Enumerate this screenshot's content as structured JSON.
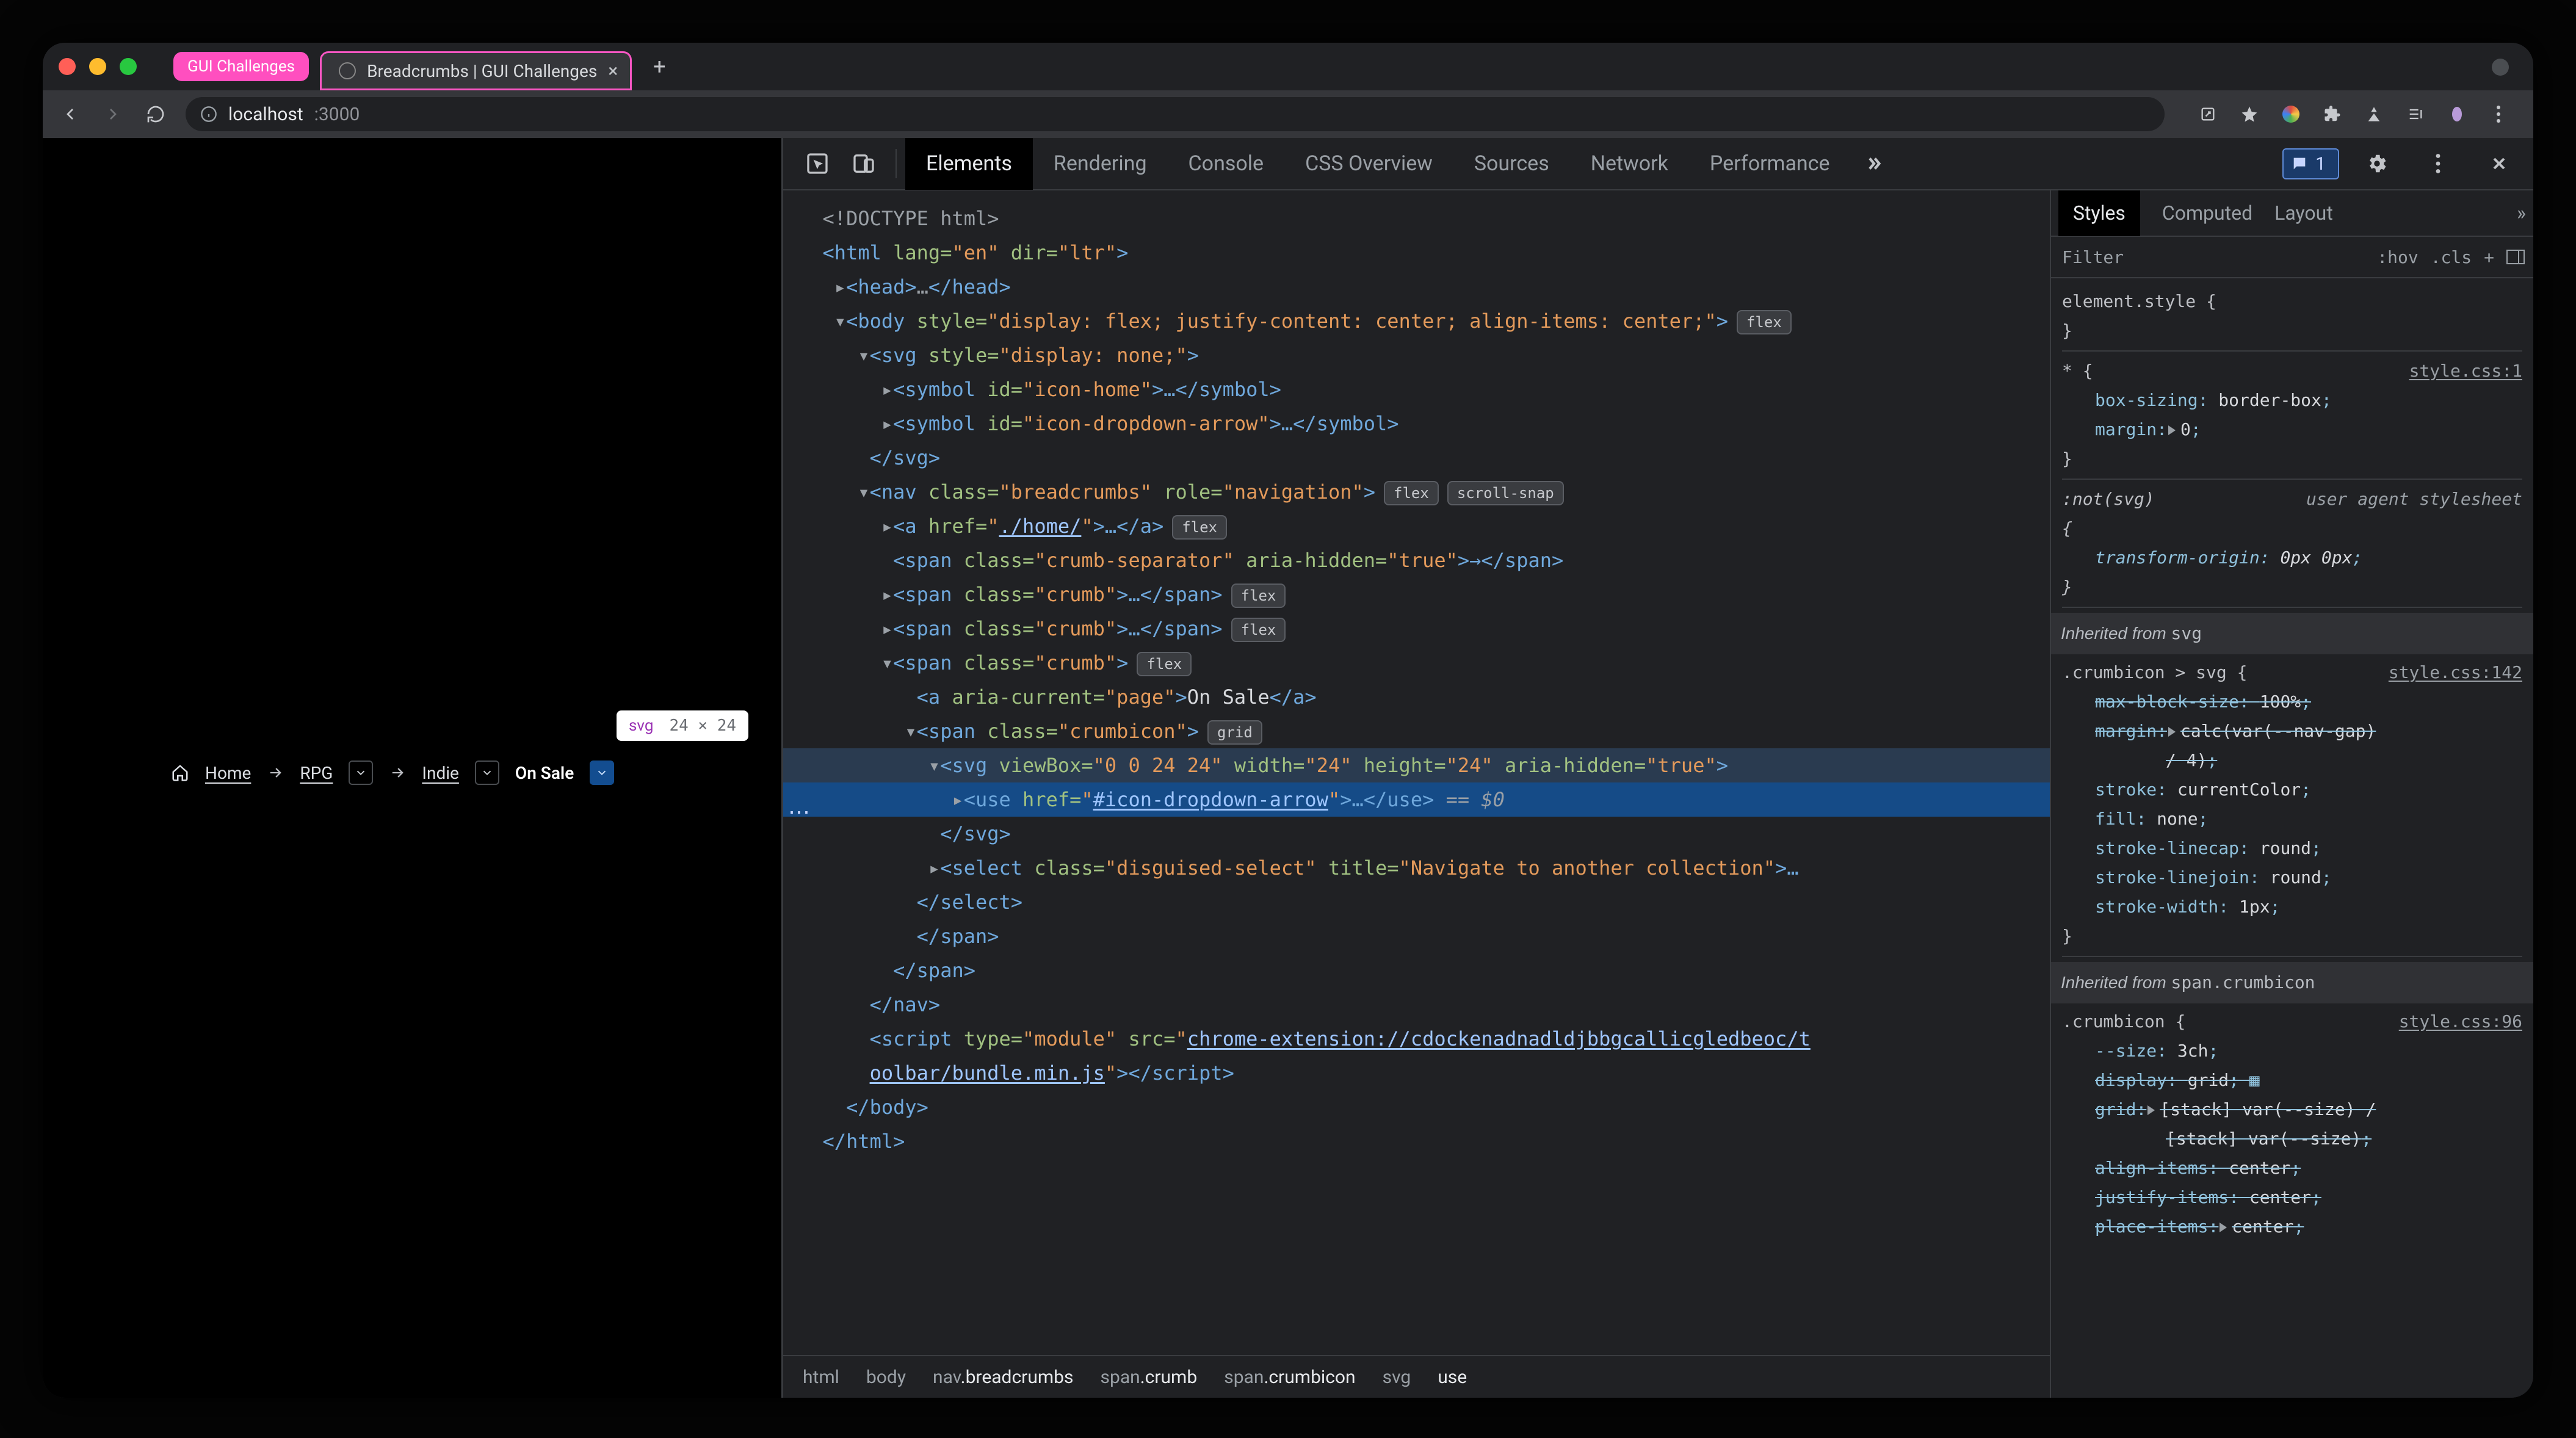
{
  "traffic": {
    "close": "#ff5f57",
    "min": "#febc2e",
    "max": "#28c840"
  },
  "tabs": {
    "pill": "GUI Challenges",
    "active": "Breadcrumbs | GUI Challenges"
  },
  "addr": {
    "host": "localhost",
    "port": ":3000"
  },
  "page": {
    "breadcrumbs": {
      "home": "Home",
      "rpg": "RPG",
      "indie": "Indie",
      "sale": "On Sale"
    },
    "tooltip": {
      "tag": "svg",
      "dim": "24 × 24"
    }
  },
  "devtools": {
    "tabs": [
      "Elements",
      "Rendering",
      "Console",
      "CSS Overview",
      "Sources",
      "Network",
      "Performance"
    ],
    "issues": "1",
    "dom": {
      "l1": "<!DOCTYPE html>",
      "l2": {
        "open": "<html ",
        "a1": "lang=",
        "v1": "\"en\"",
        "a2": " dir=",
        "v2": "\"ltr\"",
        "close": ">"
      },
      "l3": "<head>…</head>",
      "l4": {
        "open": "<body ",
        "a1": "style=",
        "v1": "\"display: flex; justify-content: center; align-items: center;\"",
        "close": ">",
        "badge": "flex"
      },
      "l5": {
        "open": "<svg ",
        "a1": "style=",
        "v1": "\"display: none;\"",
        "close": ">"
      },
      "l6": {
        "sym1": "<symbol ",
        "a1": "id=",
        "v1": "\"icon-home\"",
        "mid": ">…</symbol>"
      },
      "l7": {
        "sym1": "<symbol ",
        "a1": "id=",
        "v1": "\"icon-dropdown-arrow\"",
        "mid": ">…</symbol>"
      },
      "l8": "</svg>",
      "l9": {
        "open": "<nav ",
        "a1": "class=",
        "v1": "\"breadcrumbs\"",
        "a2": " role=",
        "v2": "\"navigation\"",
        "close": ">",
        "b1": "flex",
        "b2": "scroll-snap"
      },
      "l10": {
        "open": "<a ",
        "a1": "href=",
        "v1": "\"./home/\"",
        "mid": ">…</a>",
        "badge": "flex"
      },
      "l11": {
        "open": "<span ",
        "a1": "class=",
        "v1": "\"crumb-separator\"",
        "a2": " aria-hidden=",
        "v2": "\"true\"",
        "mid": ">→</span>"
      },
      "l12": {
        "open": "<span ",
        "a1": "class=",
        "v1": "\"crumb\"",
        "mid": ">…</span>",
        "badge": "flex"
      },
      "l13": {
        "open": "<span ",
        "a1": "class=",
        "v1": "\"crumb\"",
        "mid": ">…</span>",
        "badge": "flex"
      },
      "l14": {
        "open": "<span ",
        "a1": "class=",
        "v1": "\"crumb\"",
        "close": ">",
        "badge": "flex"
      },
      "l15": {
        "open": "<a ",
        "a1": "aria-current=",
        "v1": "\"page\"",
        "mid": ">",
        "text": "On Sale",
        "end": "</a>"
      },
      "l16": {
        "open": "<span ",
        "a1": "class=",
        "v1": "\"crumbicon\"",
        "close": ">",
        "badge": "grid"
      },
      "l17": {
        "open": "<svg ",
        "a1": "viewBox=",
        "v1": "\"0 0 24 24\"",
        "a2": " width=",
        "v2": "\"24\"",
        "a3": " height=",
        "v3": "\"24\"",
        "a4": " aria-hidden=",
        "v4": "\"true\"",
        "close": ">"
      },
      "l18": {
        "open": "<use ",
        "a1": "href=",
        "v1": "\"#icon-dropdown-arrow\"",
        "mid": ">…</use>",
        "eq": " == ",
        "var": "$0"
      },
      "l19": "</svg>",
      "l20": {
        "open": "<select ",
        "a1": "class=",
        "v1": "\"disguised-select\"",
        "a2": " title=",
        "v2": "\"Navigate to another collection\"",
        "close": ">…"
      },
      "l21": "</select>",
      "l22": "</span>",
      "l23": "</span>",
      "l24": "</nav>",
      "l25": {
        "open": "<script ",
        "a1": "type=",
        "v1": "\"module\"",
        "a2": " src=",
        "v2a": "\"",
        "v2link": "chrome-extension://cdockenadnadldjbbgcallicgledbeoc/t",
        "v2link2": "oolbar/bundle.min.js",
        "v2b": "\"",
        "mid": "></script>"
      },
      "l26": "</body>",
      "l27": "</html>"
    },
    "crumbtrail": [
      "html",
      "body",
      "nav",
      ".breadcrumbs",
      "span",
      ".crumb",
      "span",
      ".crumbicon",
      "svg",
      "use"
    ]
  },
  "styles": {
    "tabs": [
      "Styles",
      "Computed",
      "Layout"
    ],
    "filter": "Filter",
    "chips": [
      ":hov",
      ".cls",
      "+"
    ],
    "rule0": {
      "sel": "element.style ",
      "brace": "{",
      "end": "}"
    },
    "rule1": {
      "sel": "* {",
      "origin": "style.css:1",
      "p1": "box-sizing",
      "v1": "border-box",
      "p2": "margin",
      "v2": "0",
      "end": "}"
    },
    "rule2": {
      "sel": ":not(svg)",
      "ua": "user agent stylesheet",
      "open": "{",
      "p1": "transform-origin",
      "v1": "0px 0px",
      "end": "}"
    },
    "sec1": {
      "text": "Inherited from ",
      "code": "svg"
    },
    "rule3": {
      "sel": ".crumbicon > svg ",
      "open": "{",
      "origin": "style.css:142",
      "p1": "max-block-size",
      "v1": "100%",
      "p2": "margin",
      "v2": "calc(var(--nav-gap)",
      "p2b": "/ 4)",
      "p3": "stroke",
      "v3": "currentColor",
      "p4": "fill",
      "v4": "none",
      "p5": "stroke-linecap",
      "v5": "round",
      "p6": "stroke-linejoin",
      "v6": "round",
      "p7": "stroke-width",
      "v7": "1px",
      "end": "}"
    },
    "sec2": {
      "text": "Inherited from ",
      "code": "span.crumbicon"
    },
    "rule4": {
      "sel": ".crumbicon ",
      "open": "{",
      "origin": "style.css:96",
      "p1": "--size",
      "v1": "3ch",
      "p2": "display",
      "v2": "grid",
      "p3": "grid",
      "v3": "[stack] var(--size) /",
      "p3b": "[stack] var(--size)",
      "p4": "align-items",
      "v4": "center",
      "p5": "justify-items",
      "v5": "center",
      "p6": "place-items",
      "v6": "center"
    }
  }
}
